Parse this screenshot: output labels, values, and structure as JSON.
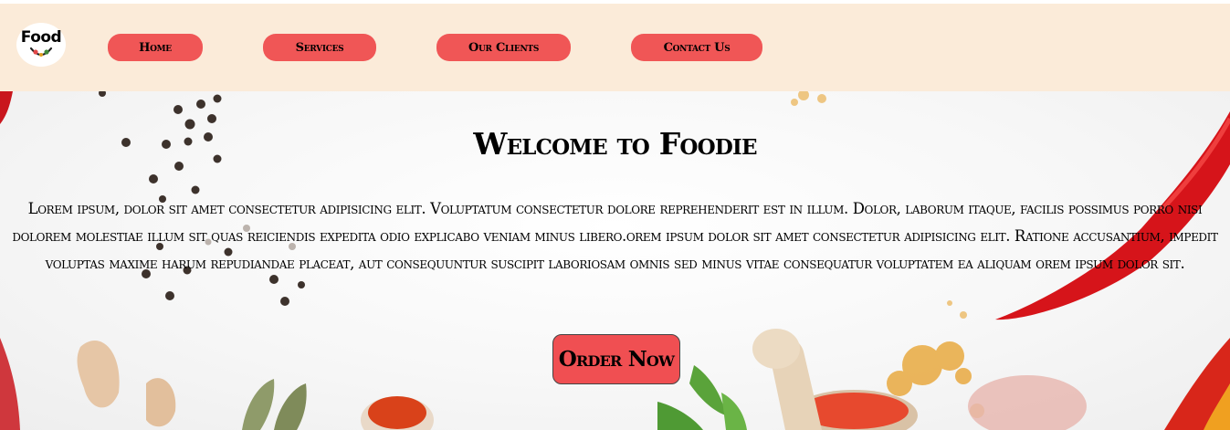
{
  "header": {
    "logo_text": "Food",
    "nav": [
      {
        "label": "Home"
      },
      {
        "label": "Services"
      },
      {
        "label": "Our Clients"
      },
      {
        "label": "Contact Us"
      }
    ]
  },
  "hero": {
    "title": "Welcome to Foodie",
    "body": "Lorem ipsum, dolor sit amet consectetur adipisicing elit. Voluptatum consectetur dolore reprehenderit est in illum. Dolor, laborum itaque, facilis possimus porro nisi dolorem molestiae illum sit quas reiciendis expedita odio explicabo veniam minus libero.orem ipsum dolor sit amet consectetur adipisicing elit. Ratione accusantium, impedit voluptas maxime harum repudiandae placeat, aut consequuntur suscipit laboriosam omnis sed minus vitae consequatur voluptatem ea aliquam orem ipsum dolor sit.",
    "cta_label": "Order Now"
  },
  "colors": {
    "navbar_bg": "#fbebd9",
    "nav_button": "#f05656",
    "cta_button": "#f04f52"
  },
  "icons": {
    "logo": "food-logo-icon"
  }
}
